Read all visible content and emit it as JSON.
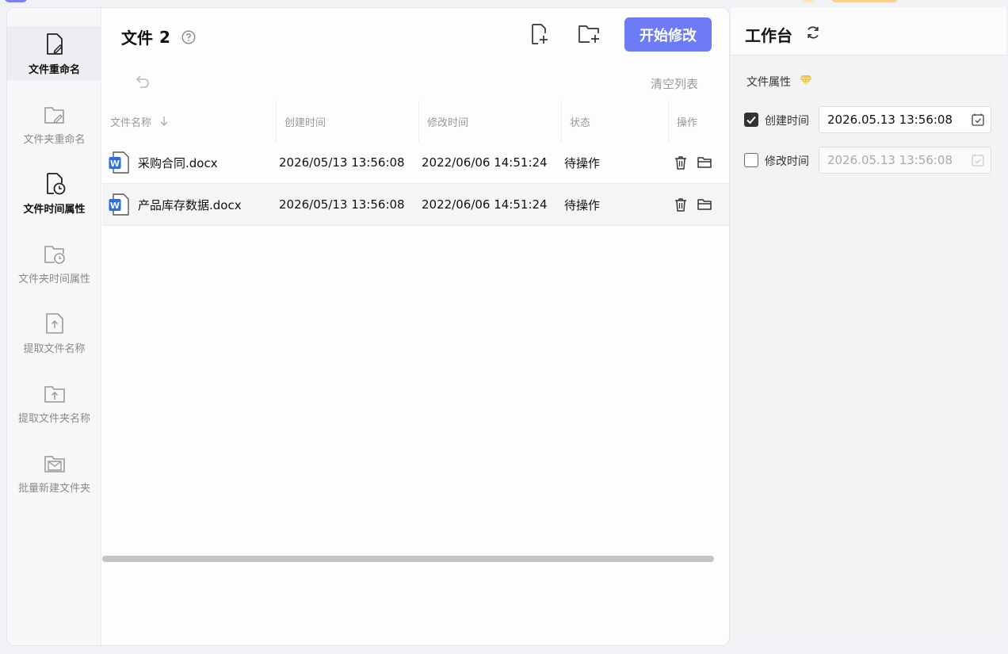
{
  "sidebar": {
    "items": [
      {
        "label": "文件重命名",
        "icon": "file-rename-icon",
        "active": true
      },
      {
        "label": "文件夹重命名",
        "icon": "folder-rename-icon"
      },
      {
        "label": "文件时间属性",
        "icon": "file-time-icon"
      },
      {
        "label": "文件夹时间属性",
        "icon": "folder-time-icon"
      },
      {
        "label": "提取文件名称",
        "icon": "extract-file-name-icon"
      },
      {
        "label": "提取文件夹名称",
        "icon": "extract-folder-name-icon"
      },
      {
        "label": "批量新建文件夹",
        "icon": "batch-new-folder-icon"
      }
    ]
  },
  "header": {
    "title": "文件",
    "count": "2",
    "start_label": "开始修改",
    "clear_label": "清空列表"
  },
  "table": {
    "columns": [
      "文件名称",
      "创建时间",
      "修改时间",
      "状态",
      "操作"
    ],
    "rows": [
      {
        "name": "采购合同.docx",
        "created": "2026/05/13 13:56:08",
        "modified": "2022/06/06 14:51:24",
        "status": "待操作"
      },
      {
        "name": "产品库存数据.docx",
        "created": "2026/05/13 13:56:08",
        "modified": "2022/06/06 14:51:24",
        "status": "待操作"
      }
    ]
  },
  "panel": {
    "title": "工作台",
    "section_label": "文件属性",
    "create_time": {
      "label": "创建时间",
      "value": "2026.05.13 13:56:08",
      "checked": true
    },
    "modify_time": {
      "label": "修改时间",
      "value": "2026.05.13 13:56:08",
      "checked": false
    }
  },
  "colors": {
    "accent": "#6d7cf6",
    "word_blue": "#2b6be6",
    "premium_gold": "#f5c242"
  }
}
